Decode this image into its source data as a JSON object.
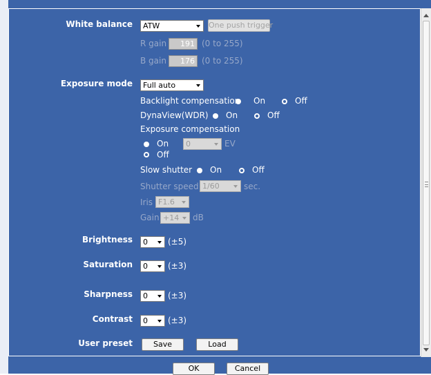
{
  "white_balance": {
    "label": "White balance",
    "mode": "ATW",
    "one_push_label": "One push trigger",
    "r_gain_label": "R gain",
    "r_gain_value": "191",
    "r_gain_range": "(0 to 255)",
    "b_gain_label": "B gain",
    "b_gain_value": "176",
    "b_gain_range": "(0 to 255)"
  },
  "exposure": {
    "label": "Exposure mode",
    "mode": "Full auto",
    "backlight_label": "Backlight compensation",
    "backlight_on": "On",
    "backlight_off": "Off",
    "dynaview_label": "DynaView(WDR)",
    "dynaview_on": "On",
    "dynaview_off": "Off",
    "comp_label": "Exposure compensation",
    "comp_on": "On",
    "comp_value": "0",
    "comp_unit": "EV",
    "comp_off": "Off",
    "slow_label": "Slow shutter",
    "slow_on": "On",
    "slow_off": "Off",
    "shutter_label": "Shutter speed",
    "shutter_value": "1/60",
    "shutter_unit": "sec.",
    "iris_label": "Iris",
    "iris_value": "F1.6",
    "gain_label": "Gain",
    "gain_value": "+14",
    "gain_unit": "dB"
  },
  "brightness": {
    "label": "Brightness",
    "value": "0",
    "range": "(±5)"
  },
  "saturation": {
    "label": "Saturation",
    "value": "0",
    "range": "(±3)"
  },
  "sharpness": {
    "label": "Sharpness",
    "value": "0",
    "range": "(±3)"
  },
  "contrast": {
    "label": "Contrast",
    "value": "0",
    "range": "(±3)"
  },
  "user_preset": {
    "label": "User preset",
    "save": "Save",
    "load": "Load"
  },
  "footer": {
    "ok": "OK",
    "cancel": "Cancel"
  },
  "colors": {
    "panel_bg": "#3c64a8",
    "label_text": "#ffffff",
    "disabled_text": "#97a8c9"
  }
}
